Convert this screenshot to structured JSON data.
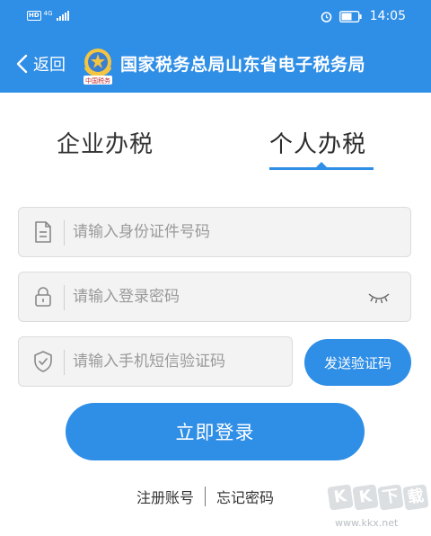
{
  "status_bar": {
    "hd": "HD",
    "network": "4G",
    "time": "14:05",
    "icons": [
      "alarm-icon",
      "battery-icon",
      "signal-icon"
    ]
  },
  "nav": {
    "back_label": "返回",
    "title": "国家税务总局山东省电子税务局",
    "emblem_text": "中国税务",
    "color": "#2f8ee6"
  },
  "tabs": [
    {
      "label": "企业办税",
      "active": false
    },
    {
      "label": "个人办税",
      "active": true
    }
  ],
  "form": {
    "id_placeholder": "请输入身份证件号码",
    "password_placeholder": "请输入登录密码",
    "sms_placeholder": "请输入手机短信验证码",
    "send_code_label": "发送验证码",
    "login_label": "立即登录"
  },
  "links": {
    "register": "注册账号",
    "forgot": "忘记密码"
  },
  "watermark": {
    "logo": [
      "K",
      "K",
      "下",
      "载"
    ],
    "url": "www.kkx.net"
  }
}
